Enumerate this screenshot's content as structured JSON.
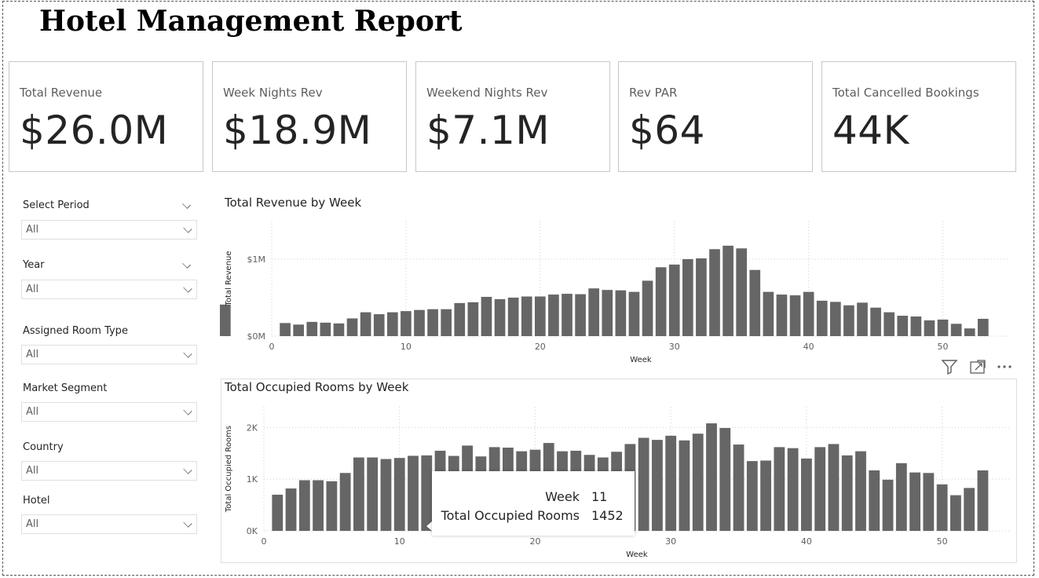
{
  "report": {
    "title": "Hotel Management Report"
  },
  "kpis": [
    {
      "label": "Total Revenue",
      "value": "$26.0M"
    },
    {
      "label": "Week Nights Rev",
      "value": "$18.9M"
    },
    {
      "label": "Weekend Nights Rev",
      "value": "$7.1M"
    },
    {
      "label": "Rev PAR",
      "value": "$64"
    },
    {
      "label": "Total Cancelled Bookings",
      "value": "44K"
    }
  ],
  "slicers": [
    {
      "label": "Select Period",
      "value": "All"
    },
    {
      "label": "Year",
      "value": "All"
    },
    {
      "label": "Assigned Room Type",
      "value": "All"
    },
    {
      "label": "Market Segment",
      "value": "All"
    },
    {
      "label": "Country",
      "value": "All"
    },
    {
      "label": "Hotel",
      "value": "All"
    }
  ],
  "tooltip": {
    "week_label": "Week",
    "week_value": "11",
    "rooms_label": "Total Occupied Rooms",
    "rooms_value": "1452"
  },
  "colors": {
    "bar": "#666666",
    "grid": "#d0d0d0",
    "text": "#252423"
  },
  "icons": [
    "filter-icon",
    "focus-mode-icon",
    "more-options-icon"
  ],
  "chart_data": [
    {
      "type": "bar",
      "title": "Total Revenue by Week",
      "xlabel": "Week",
      "ylabel": "Total Revenue",
      "x": [
        1,
        2,
        3,
        4,
        5,
        6,
        7,
        8,
        9,
        10,
        11,
        12,
        13,
        14,
        15,
        16,
        17,
        18,
        19,
        20,
        21,
        22,
        23,
        24,
        25,
        26,
        27,
        28,
        29,
        30,
        31,
        32,
        33,
        34,
        35,
        36,
        37,
        38,
        39,
        40,
        41,
        42,
        43,
        44,
        45,
        46,
        47,
        48,
        49,
        50,
        51,
        52,
        53
      ],
      "values": [
        170000,
        150000,
        185000,
        175000,
        165000,
        230000,
        310000,
        285000,
        310000,
        325000,
        340000,
        350000,
        350000,
        430000,
        440000,
        510000,
        480000,
        500000,
        515000,
        515000,
        540000,
        550000,
        545000,
        620000,
        600000,
        595000,
        575000,
        720000,
        895000,
        930000,
        1000000,
        1010000,
        1130000,
        1175000,
        1140000,
        860000,
        575000,
        540000,
        530000,
        575000,
        460000,
        445000,
        400000,
        435000,
        370000,
        310000,
        265000,
        255000,
        205000,
        215000,
        160000,
        100000,
        225000,
        410000
      ],
      "xticks": [
        "0",
        "10",
        "20",
        "30",
        "40",
        "50"
      ],
      "yticks": [
        "$0M",
        "$1M"
      ],
      "xlim": [
        0,
        55
      ],
      "ylim": [
        0,
        1500000
      ],
      "grid": true
    },
    {
      "type": "bar",
      "title": "Total Occupied Rooms by Week",
      "xlabel": "Week",
      "ylabel": "Total Occupied Rooms",
      "x": [
        1,
        2,
        3,
        4,
        5,
        6,
        7,
        8,
        9,
        10,
        11,
        12,
        13,
        14,
        15,
        16,
        17,
        18,
        19,
        20,
        21,
        22,
        23,
        24,
        25,
        26,
        27,
        28,
        29,
        30,
        31,
        32,
        33,
        34,
        35,
        36,
        37,
        38,
        39,
        40,
        41,
        42,
        43,
        44,
        45,
        46,
        47,
        48,
        49,
        50,
        51,
        52,
        53
      ],
      "values": [
        700,
        820,
        980,
        980,
        960,
        1120,
        1420,
        1420,
        1390,
        1410,
        1452,
        1460,
        1550,
        1450,
        1650,
        1440,
        1620,
        1610,
        1540,
        1570,
        1700,
        1540,
        1550,
        1470,
        1420,
        1530,
        1680,
        1800,
        1760,
        1840,
        1750,
        1880,
        2080,
        1990,
        1670,
        1350,
        1360,
        1620,
        1600,
        1400,
        1620,
        1680,
        1460,
        1540,
        1170,
        990,
        1310,
        1130,
        1120,
        900,
        690,
        830,
        1170
      ],
      "xticks": [
        "0",
        "10",
        "20",
        "30",
        "40",
        "50"
      ],
      "yticks": [
        "0K",
        "1K",
        "2K"
      ],
      "xlim": [
        0,
        55
      ],
      "ylim": [
        0,
        2400
      ],
      "grid": true
    }
  ]
}
